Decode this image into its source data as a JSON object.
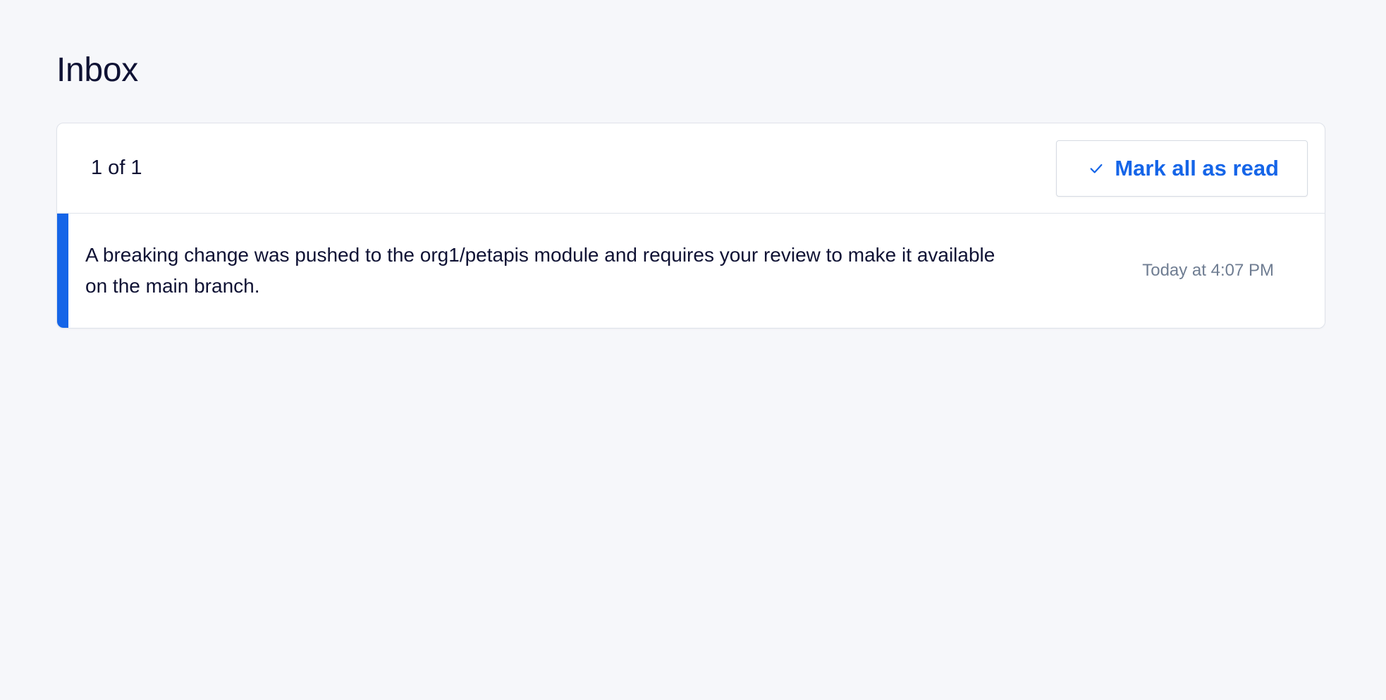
{
  "page": {
    "title": "Inbox"
  },
  "inbox": {
    "count_text": "1 of 1",
    "mark_all_label": "Mark all as read",
    "notifications": [
      {
        "message": "A breaking change was pushed to the org1/petapis module and requires your review to make it available on the main branch.",
        "time": "Today at 4:07 PM",
        "unread": true
      }
    ]
  },
  "icons": {
    "mark_all": "check-icon"
  },
  "colors": {
    "accent": "#1565e8",
    "background": "#f6f7fa",
    "text": "#0f1234",
    "muted": "#6f7d92"
  }
}
